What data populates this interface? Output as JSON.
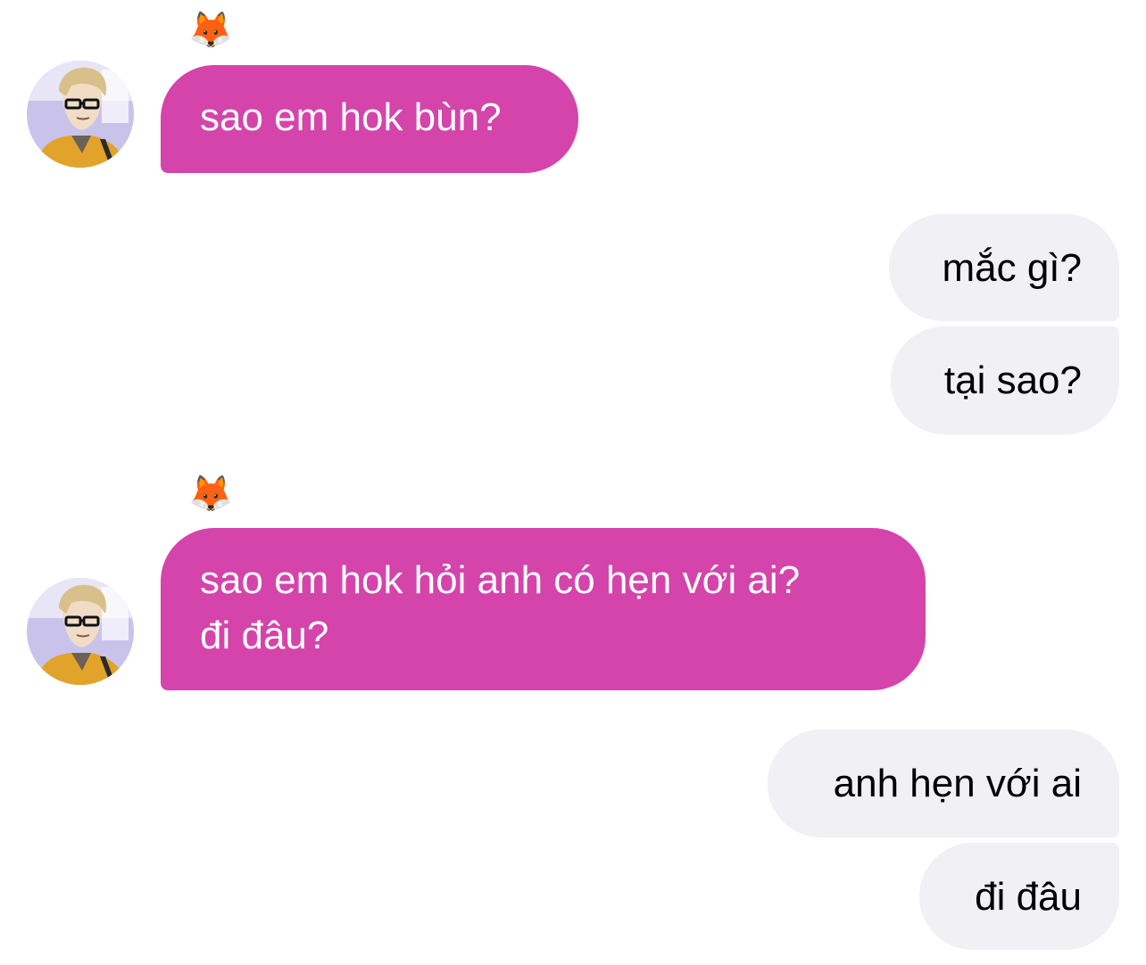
{
  "chat": {
    "incoming_color": "#d444aa",
    "outgoing_color": "#f0f0f5",
    "contact": {
      "display_name": "🦊",
      "avatar_icon": "man-with-glasses-avatar"
    },
    "messages": [
      {
        "direction": "incoming",
        "text": "sao em hok bùn?"
      },
      {
        "direction": "outgoing",
        "text": "mắc gì?"
      },
      {
        "direction": "outgoing",
        "text": "tại sao?"
      },
      {
        "direction": "incoming",
        "text": "sao em hok hỏi anh có hẹn với ai?\nđi đâu?"
      },
      {
        "direction": "outgoing",
        "text": "anh hẹn với ai"
      },
      {
        "direction": "outgoing",
        "text": "đi đâu"
      }
    ]
  }
}
